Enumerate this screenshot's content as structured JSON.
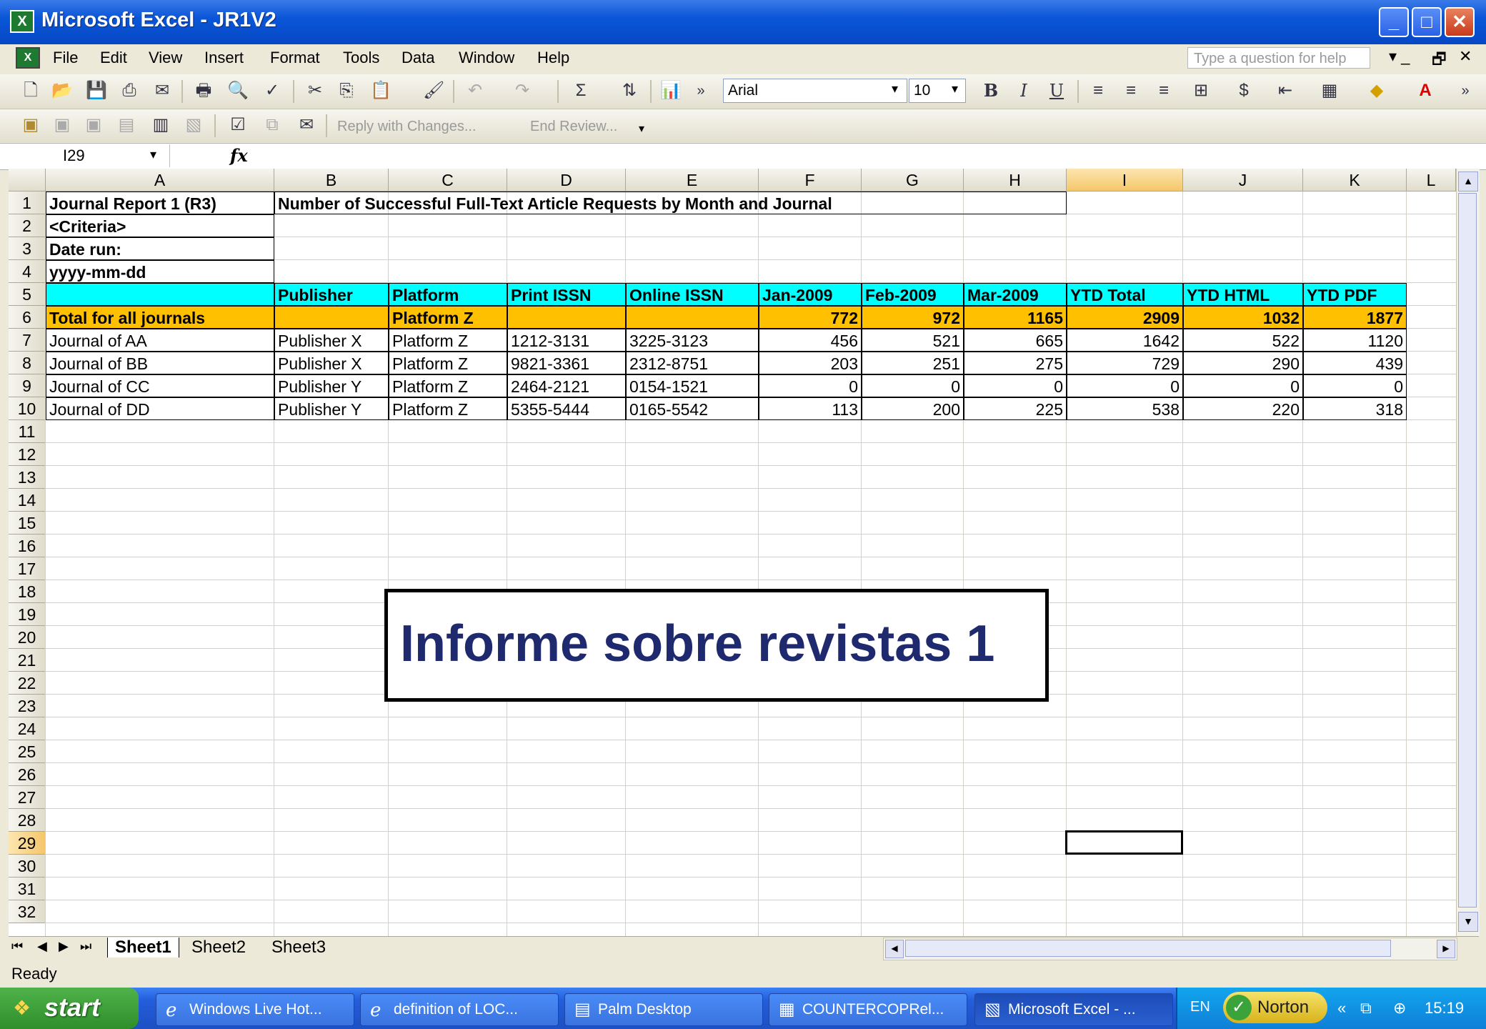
{
  "window": {
    "title": "Microsoft Excel - JR1V2"
  },
  "menu": [
    "File",
    "Edit",
    "View",
    "Insert",
    "Format",
    "Tools",
    "Data",
    "Window",
    "Help"
  ],
  "help_placeholder": "Type a question for help",
  "toolbar": {
    "font": "Arial",
    "size": "10",
    "reply_changes": "Reply with Changes...",
    "end_review": "End Review..."
  },
  "formula_bar": {
    "name_box": "I29",
    "fx": "fx"
  },
  "columns": [
    "A",
    "B",
    "C",
    "D",
    "E",
    "F",
    "G",
    "H",
    "I",
    "J",
    "K",
    "L"
  ],
  "rows": [
    "1",
    "2",
    "3",
    "4",
    "5",
    "6",
    "7",
    "8",
    "9",
    "10",
    "11",
    "12",
    "13",
    "14",
    "15",
    "16",
    "17",
    "18",
    "19",
    "20",
    "21",
    "22",
    "23",
    "24",
    "25",
    "26",
    "27",
    "28",
    "29",
    "30",
    "31",
    "32"
  ],
  "sheet": {
    "a1": "Journal Report 1 (R3)",
    "b1": "Number of Successful Full-Text Article Requests by Month and Journal",
    "a2": "<Criteria>",
    "a3": "Date run:",
    "a4": "yyyy-mm-dd",
    "headers": [
      "Publisher",
      "Platform",
      "Print ISSN",
      "Online ISSN",
      "Jan-2009",
      "Feb-2009",
      "Mar-2009",
      "YTD Total",
      "YTD HTML",
      "YTD PDF"
    ],
    "total": [
      "Total for all journals",
      "",
      "Platform Z",
      "",
      "",
      "772",
      "972",
      "1165",
      "2909",
      "1032",
      "1877"
    ],
    "data": [
      [
        "Journal of AA",
        "Publisher X",
        "Platform Z",
        "1212-3131",
        "3225-3123",
        "456",
        "521",
        "665",
        "1642",
        "522",
        "1120"
      ],
      [
        "Journal of BB",
        "Publisher X",
        "Platform Z",
        "9821-3361",
        "2312-8751",
        "203",
        "251",
        "275",
        "729",
        "290",
        "439"
      ],
      [
        "Journal of CC",
        "Publisher Y",
        "Platform Z",
        "2464-2121",
        "0154-1521",
        "0",
        "0",
        "0",
        "0",
        "0",
        "0"
      ],
      [
        "Journal of DD",
        "Publisher Y",
        "Platform Z",
        "5355-5444",
        "0165-5542",
        "113",
        "200",
        "225",
        "538",
        "220",
        "318"
      ]
    ]
  },
  "overlay_text": "Informe sobre revistas 1",
  "sheets": [
    "Sheet1",
    "Sheet2",
    "Sheet3"
  ],
  "status": "Ready",
  "taskbar": {
    "start": "start",
    "tasks": [
      "Windows Live Hot...",
      "definition of LOC...",
      "Palm Desktop",
      "COUNTERCOPRel...",
      "Microsoft Excel - ..."
    ],
    "lang": "EN",
    "norton": "Norton",
    "clock": "15:19"
  },
  "colors": {
    "header_fill": "#00ffff",
    "total_fill": "#ffc000",
    "title_blue": "#0a56d8",
    "overlay_text": "#1f2a6e"
  }
}
